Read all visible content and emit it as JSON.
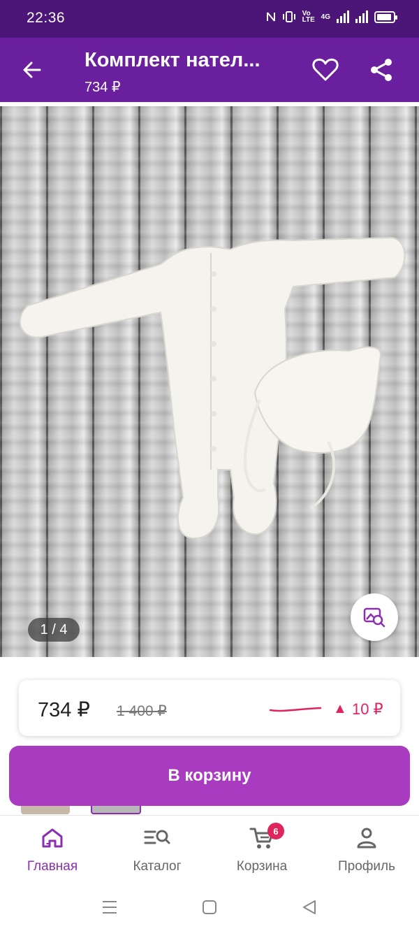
{
  "status_bar": {
    "time": "22:36",
    "volte_label": "Vo LTE",
    "network_label": "4G"
  },
  "header": {
    "title": "Комплект нател...",
    "price": "734 ₽",
    "back_icon": "arrow-left-icon",
    "favorite_icon": "heart-icon",
    "share_icon": "share-icon"
  },
  "gallery": {
    "counter": "1 / 4",
    "visual_search_icon": "image-search-icon"
  },
  "price_card": {
    "current_price": "734 ₽",
    "old_price": "1 400 ₽",
    "trend_arrow": "▲",
    "trend_value": "10 ₽",
    "trend_color": "#e0245e"
  },
  "cart_button": {
    "label": "В корзину",
    "color": "#a93bc0"
  },
  "bottom_nav": {
    "items": [
      {
        "label": "Главная",
        "icon": "home-icon",
        "active": true
      },
      {
        "label": "Каталог",
        "icon": "catalog-search-icon",
        "active": false
      },
      {
        "label": "Корзина",
        "icon": "cart-icon",
        "active": false,
        "badge": "6"
      },
      {
        "label": "Профиль",
        "icon": "profile-icon",
        "active": false
      }
    ],
    "active_color": "#8b2fb0"
  },
  "colors": {
    "status_bar": "#4b1678",
    "app_bar": "#6a1f9f"
  }
}
